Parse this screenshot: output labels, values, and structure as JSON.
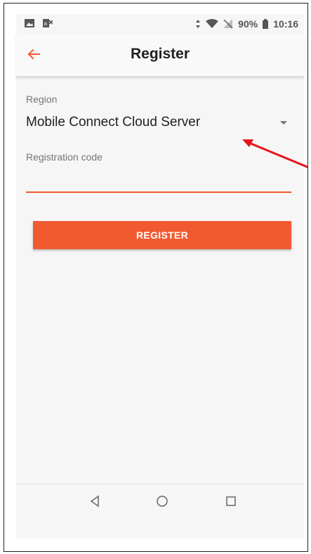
{
  "status_bar": {
    "battery_percent": "90%",
    "time": "10:16",
    "icons": [
      "image-icon",
      "dictionary-icon",
      "data-arrows-icon",
      "wifi-icon",
      "no-signal-icon",
      "battery-icon"
    ]
  },
  "app_bar": {
    "title": "Register",
    "back_icon": "arrow-left-icon"
  },
  "form": {
    "region_label": "Region",
    "region_value": "Mobile Connect Cloud Server",
    "registration_code_label": "Registration code",
    "registration_code_value": ""
  },
  "register_button": {
    "label": "REGISTER"
  },
  "nav_bar": {
    "buttons": [
      "back-triangle-icon",
      "home-circle-icon",
      "recents-square-icon"
    ]
  },
  "colors": {
    "accent": "#f15a31",
    "background": "#f6f6f6",
    "annotation_arrow": "#e8141c"
  }
}
